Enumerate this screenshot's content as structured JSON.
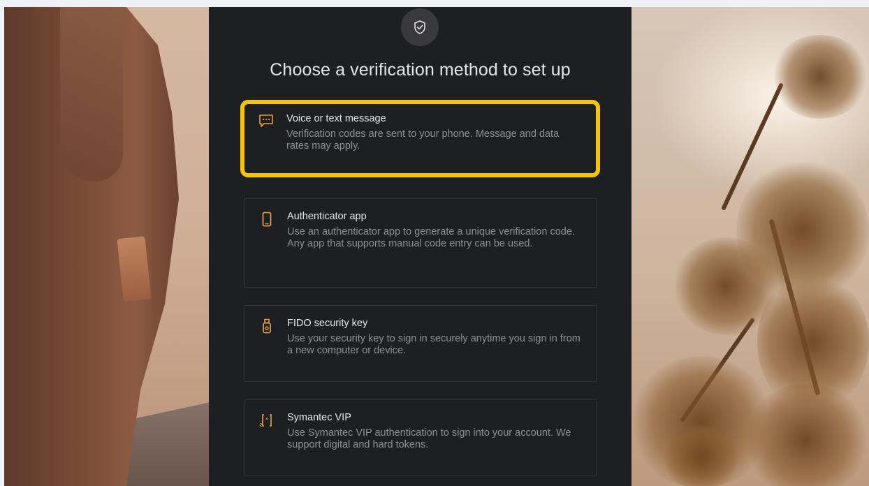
{
  "page": {
    "title": "Choose a verification method to set up"
  },
  "options": [
    {
      "name": "Voice or text message",
      "description": "Verification codes are sent to your phone. Message and data rates may apply.",
      "icon": "chat-bubble-icon",
      "selected": true
    },
    {
      "name": "Authenticator app",
      "description": "Use an authenticator app to generate a unique verification code. Any app that supports manual code entry can be used.",
      "icon": "phone-icon",
      "selected": false
    },
    {
      "name": "FIDO security key",
      "description": "Use your security key to sign in securely anytime you sign in from a new computer or device.",
      "icon": "usb-key-icon",
      "selected": false
    },
    {
      "name": "Symantec VIP",
      "description": "Use Symantec VIP authentication to sign into your account. We support digital and hard tokens.",
      "icon": "token-icon",
      "selected": false
    }
  ],
  "colors": {
    "accent": "#f7c400",
    "icon": "#e8a33d",
    "panel": "#1e1f22"
  }
}
